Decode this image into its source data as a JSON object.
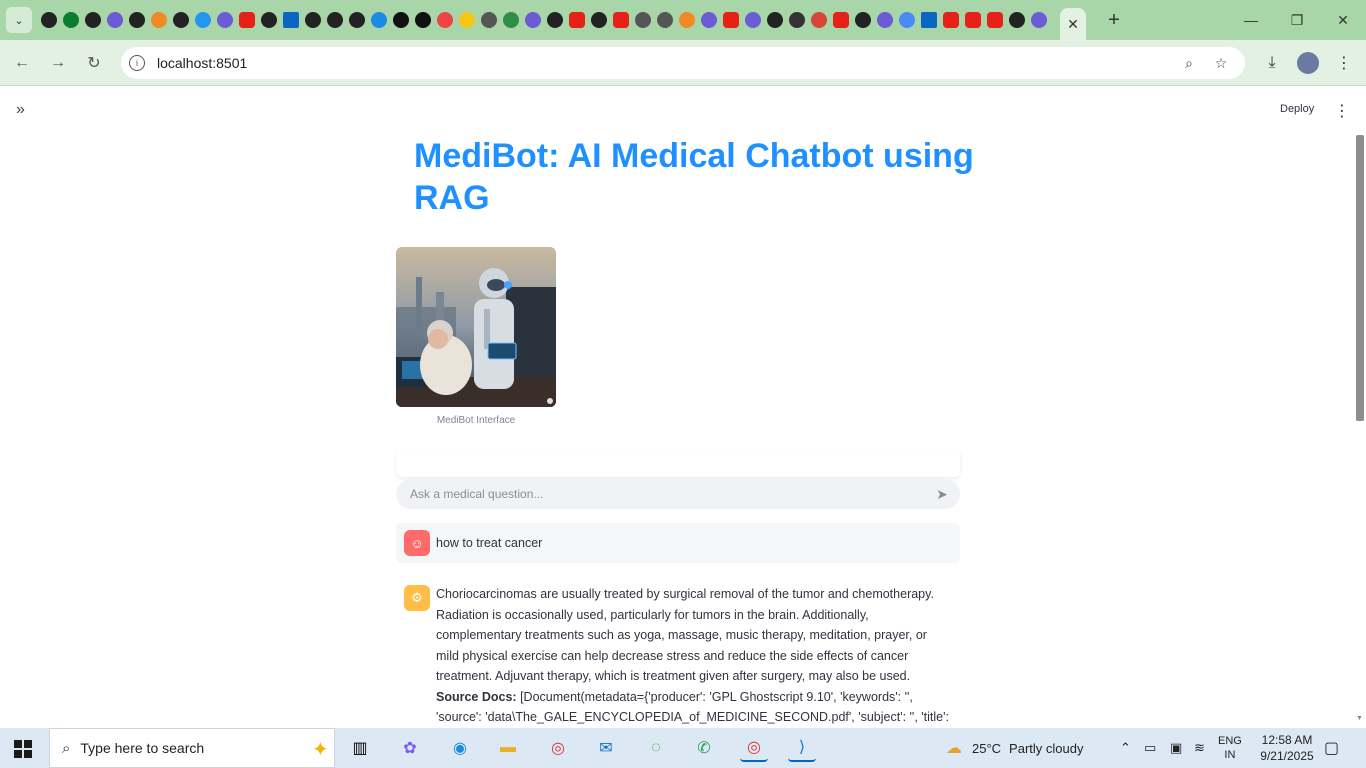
{
  "browser": {
    "tab_favicons": [
      "github",
      "github-green",
      "github",
      "icon",
      "github",
      "box",
      "github",
      "docker",
      "icon",
      "youtube",
      "github",
      "linkedin",
      "aws",
      "github",
      "github",
      "react",
      "A",
      "tt",
      "9",
      "emoji",
      "globe",
      "gfg",
      "icon",
      "github",
      "youtube",
      "github",
      "youtube",
      "chart",
      "chart",
      "arrow",
      "icon",
      "youtube",
      "icon",
      "openai",
      "info",
      "gmail",
      "youtube",
      "github",
      "icon",
      "gemini",
      "linkedin",
      "youtube",
      "youtube",
      "youtube",
      "github",
      "icon"
    ],
    "active_tab_close": "✕",
    "new_tab": "+",
    "url": "localhost:8501"
  },
  "app": {
    "deploy_label": "Deploy",
    "title": "MediBot: AI Medical Chatbot using RAG",
    "image_caption": "MediBot Interface",
    "chat_placeholder": "Ask a medical question...",
    "messages": [
      {
        "role": "user",
        "text": "how to treat cancer"
      },
      {
        "role": "assistant",
        "text": "Choriocarcinomas are usually treated by surgical removal of the tumor and chemotherapy. Radiation is occasionally used, particularly for tumors in the brain. Additionally, complementary treatments such as yoga, massage, music therapy, meditation, prayer, or mild physical exercise can help decrease stress and reduce the side effects of cancer treatment. Adjuvant therapy, which is treatment given after surgery, may also be used.",
        "source_label": "Source Docs:",
        "source_text": "[Document(metadata={'producer': 'GPL Ghostscript 9.10', 'keywords': '', 'source': 'data\\The_GALE_ENCYCLOPEDIA_of_MEDICINE_SECOND.pdf', 'subject': '', 'title': '', 'creationdate':"
      }
    ]
  },
  "taskbar": {
    "search_placeholder": "Type here to search",
    "weather_temp": "25°C",
    "weather_text": "Partly cloudy",
    "lang_line1": "ENG",
    "lang_line2": "IN",
    "time": "12:58 AM",
    "date": "9/21/2025"
  }
}
